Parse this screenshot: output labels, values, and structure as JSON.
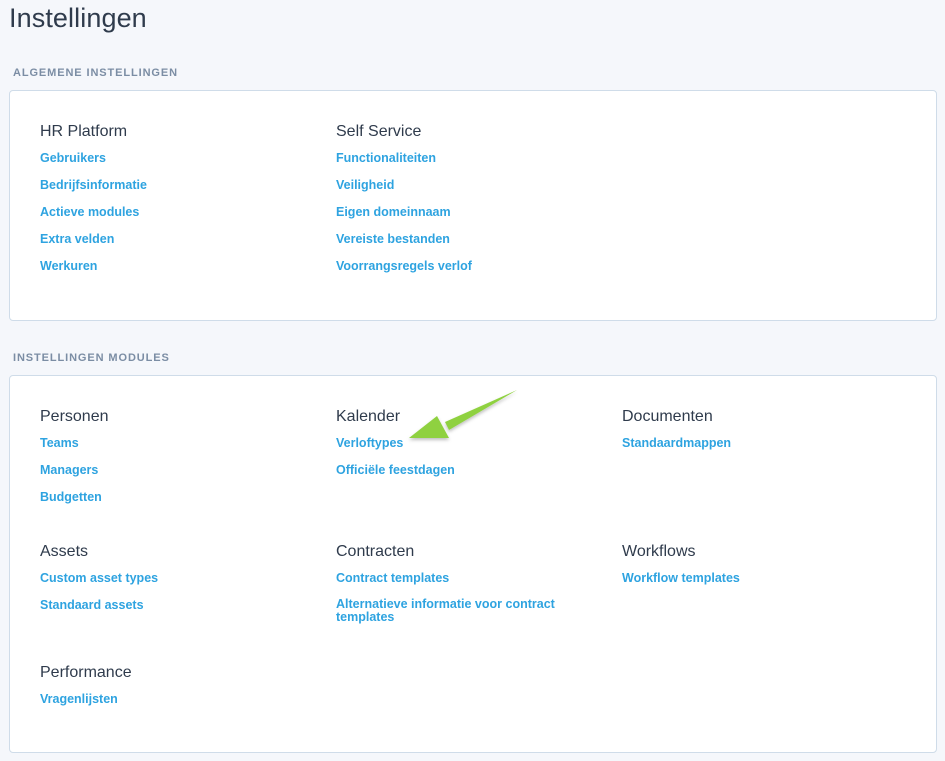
{
  "page": {
    "title": "Instellingen"
  },
  "general": {
    "heading": "ALGEMENE INSTELLINGEN",
    "groups": [
      {
        "title": "HR Platform",
        "links": [
          "Gebruikers",
          "Bedrijfsinformatie",
          "Actieve modules",
          "Extra velden",
          "Werkuren"
        ]
      },
      {
        "title": "Self Service",
        "links": [
          "Functionaliteiten",
          "Veiligheid",
          "Eigen domeinnaam",
          "Vereiste bestanden",
          "Voorrangsregels verlof"
        ]
      }
    ]
  },
  "modules": {
    "heading": "INSTELLINGEN MODULES",
    "groups": [
      {
        "title": "Personen",
        "links": [
          "Teams",
          "Managers",
          "Budgetten"
        ]
      },
      {
        "title": "Kalender",
        "links": [
          "Verloftypes",
          "Officiële feestdagen"
        ]
      },
      {
        "title": "Documenten",
        "links": [
          "Standaardmappen"
        ]
      },
      {
        "title": "Assets",
        "links": [
          "Custom asset types",
          "Standaard assets"
        ]
      },
      {
        "title": "Contracten",
        "links": [
          "Contract templates",
          "Alternatieve informatie voor contract templates"
        ]
      },
      {
        "title": "Workflows",
        "links": [
          "Workflow templates"
        ]
      },
      {
        "title": "Performance",
        "links": [
          "Vragenlijsten"
        ]
      }
    ]
  },
  "colors": {
    "link": "#2ea3e0",
    "heading": "#7b8da4",
    "title": "#2f3b4c",
    "annotation_arrow": "#8fd13f"
  },
  "annotation": {
    "icon": "arrow-pointer-icon"
  }
}
